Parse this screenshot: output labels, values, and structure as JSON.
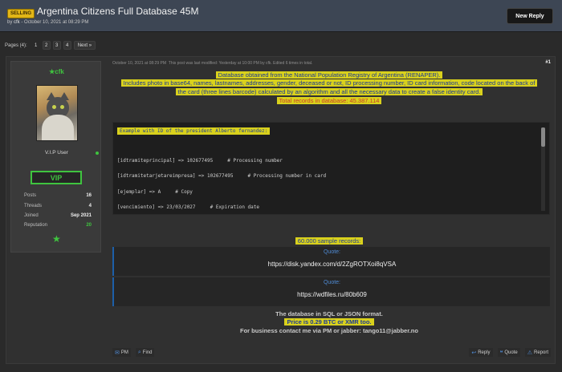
{
  "thread": {
    "badge": "SELLING",
    "title": "Argentina Citizens Full Database 45M",
    "author": "cfk",
    "date": "October 10, 2021 at 08:29 PM",
    "new_reply": "New Reply"
  },
  "pagination": {
    "label": "Pages (4):",
    "pages": [
      "1",
      "2",
      "3",
      "4"
    ],
    "next": "Next »"
  },
  "user": {
    "name": "cfk",
    "title": "V.I.P User",
    "badge": "VIP",
    "stats": [
      {
        "label": "Posts",
        "value": "16"
      },
      {
        "label": "Threads",
        "value": "4"
      },
      {
        "label": "Joined",
        "value": "Sep 2021"
      },
      {
        "label": "Reputation",
        "value": "20"
      }
    ],
    "accent": "#3fc43f"
  },
  "post": {
    "date": "October 10, 2021 at 08:29 PM",
    "edit_note": "This post was last modified: Yesterday at 10:00 PM by cfk. Edited 6 times in total.",
    "number": "#1",
    "intro": [
      "Database obtained from the National Population Registry of Argentina (RENAPER).",
      "Includes photo in base64, names, lastnames, addresses, gender, deceased or not, ID processing number, ID card information, code located on the back of",
      "the card (three lines barcode) calculated by an algorithm and all the necessary data to create a false identity card.",
      "Total records in database: 45.387.114"
    ],
    "code": {
      "header": "Example with ID of the president Alberto fernandez:",
      "lines": [
        "[idtramiteprincipal] => 102677495     # Processing number",
        "[idtramitetarjetareimpresa] => 102677495     # Processing number in card",
        "[ejemplar] => A     # Copy",
        "[vencimiento] => 23/03/2027     # Expiration date"
      ]
    },
    "sample_label": "60.000 sample records:",
    "quotes": [
      {
        "label": "Quote:",
        "text": "https://disk.yandex.com/d/2ZgROTXoi8qVSA"
      },
      {
        "label": "Quote:",
        "text": "https://wdfiles.ru/80b609"
      }
    ],
    "format_line": "The database in SQL or JSON format.",
    "price_line": "Price is 0.29 BTC or XMR too.",
    "contact_line": "For business contact me via PM or jabber: tango11@jabber.no"
  },
  "actions": {
    "pm": "PM",
    "find": "Find",
    "reply": "Reply",
    "quote": "Quote",
    "report": "Report"
  },
  "watermark": "ELDISENSO",
  "colors": {
    "highlight_bg": "#d9d11c",
    "highlight_text": "#1c3a96",
    "total_text": "#c93a2d",
    "link_blue": "#4f8ad3",
    "badge_gold": "#e2b617"
  }
}
